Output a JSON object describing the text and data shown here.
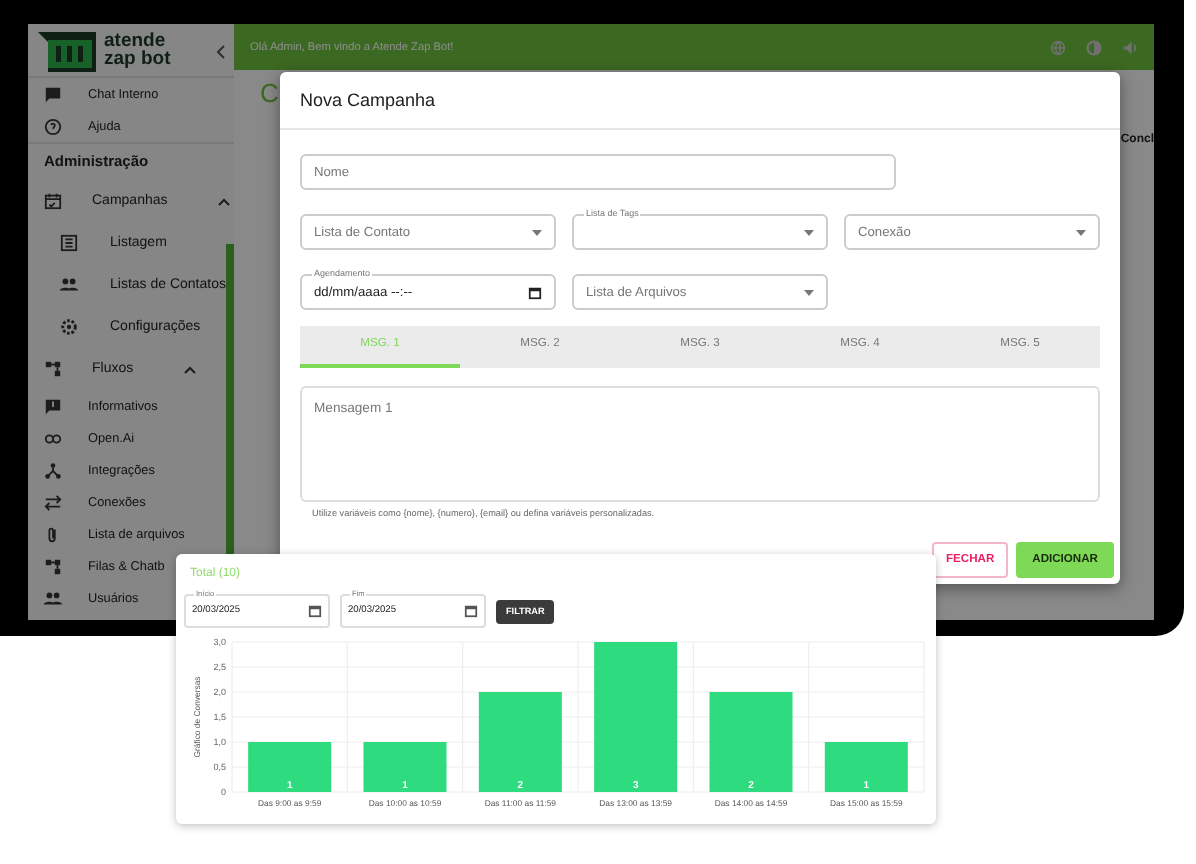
{
  "logo": {
    "text": "atende zap bot"
  },
  "topbar": {
    "greeting": "Olá Admin, Bem vindo a Atende Zap Bot!"
  },
  "sidebar": {
    "items": [
      {
        "kind": "item",
        "label": "Chat Interno"
      },
      {
        "kind": "item",
        "label": "Ajuda"
      },
      {
        "kind": "header",
        "label": "Administração"
      },
      {
        "kind": "group",
        "label": "Campanhas",
        "expanded": true,
        "children": [
          {
            "kind": "subitem",
            "label": "Listagem"
          },
          {
            "kind": "subitem",
            "label": "Listas de Contatos"
          },
          {
            "kind": "subitem",
            "label": "Configurações"
          }
        ]
      },
      {
        "kind": "group",
        "label": "Fluxos",
        "expanded": true
      },
      {
        "kind": "item",
        "label": "Informativos"
      },
      {
        "kind": "item",
        "label": "Open.Ai"
      },
      {
        "kind": "item",
        "label": "Integrações"
      },
      {
        "kind": "item",
        "label": "Conexões"
      },
      {
        "kind": "item",
        "label": "Lista de arquivos"
      },
      {
        "kind": "item",
        "label": "Filas & Chatb"
      },
      {
        "kind": "item",
        "label": "Usuários"
      }
    ]
  },
  "page": {
    "title": "C",
    "column_1": "Concl"
  },
  "modal": {
    "title": "Nova Campanha",
    "name_field": {
      "placeholder": "Nome"
    },
    "selects": [
      {
        "placeholder": "Lista de Contato"
      },
      {
        "label": "Lista de Tags"
      },
      {
        "placeholder": "Conexão"
      }
    ],
    "schedule_field": {
      "label": "Agendamento",
      "value": "dd/mm/aaaa --:--"
    },
    "files_select": {
      "placeholder": "Lista de Arquivos"
    },
    "tabs": [
      {
        "label": "MSG. 1",
        "selected": true
      },
      {
        "label": "MSG. 2",
        "selected": false
      },
      {
        "label": "MSG. 3",
        "selected": false
      },
      {
        "label": "MSG. 4",
        "selected": false
      },
      {
        "label": "MSG. 5",
        "selected": false
      }
    ],
    "message_field": {
      "placeholder": "Mensagem 1"
    },
    "hint": "Utilize variáveis como {nome}, {numero}, {email} ou defina variáveis personalizadas.",
    "buttons": [
      {
        "kind": "outlined",
        "label": "FECHAR"
      },
      {
        "kind": "contained",
        "label": "ADICIONAR"
      }
    ]
  },
  "report": {
    "title": "Total (10)",
    "start_field": {
      "label": "Início",
      "value": "20/03/2025"
    },
    "end_field": {
      "label": "Fim",
      "value": "20/03/2025"
    },
    "filter_button": "FILTRAR",
    "chart_data": {
      "type": "bar",
      "ylabel": "Gráfico de Conversas",
      "categories": [
        "Das 9:00 as 9:59",
        "Das 10:00 as 10:59",
        "Das 11:00 as 11:59",
        "Das 13:00 as 13:59",
        "Das 14:00 as 14:59",
        "Das 15:00 as 15:59"
      ],
      "values": [
        1,
        1,
        2,
        3,
        2,
        1
      ],
      "grid": true,
      "ylim": [
        0,
        3
      ],
      "yticks": [
        {
          "value": 0,
          "label": "0"
        },
        {
          "value": 0.5,
          "label": "0,5"
        },
        {
          "value": 1,
          "label": "1,0"
        },
        {
          "value": 1.5,
          "label": "1,5"
        },
        {
          "value": 2,
          "label": "2,0"
        },
        {
          "value": 2.5,
          "label": "2,5"
        },
        {
          "value": 3,
          "label": "3,0"
        }
      ],
      "data_labels": true
    }
  }
}
